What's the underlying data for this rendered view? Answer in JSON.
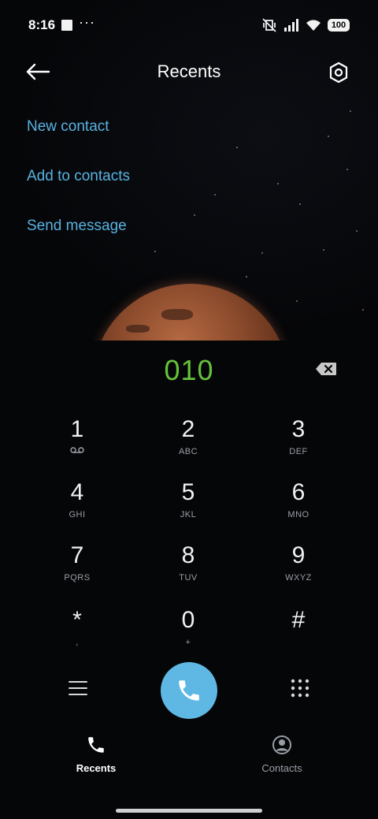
{
  "status_bar": {
    "time": "8:16",
    "more_indicator": "···",
    "battery_level": "100",
    "icons": [
      "notification-square-icon",
      "mute-vibrate-icon",
      "signal-icon",
      "wifi-icon",
      "battery-icon"
    ]
  },
  "header": {
    "title": "Recents",
    "back_icon": "back-arrow-icon",
    "settings_icon": "settings-icon"
  },
  "menu": {
    "items": [
      {
        "label": "New contact"
      },
      {
        "label": "Add to contacts"
      },
      {
        "label": "Send message"
      }
    ]
  },
  "dialer": {
    "number": "010",
    "number_color": "#67c23a",
    "keys": [
      {
        "digit": "1",
        "letters": ""
      },
      {
        "digit": "2",
        "letters": "ABC"
      },
      {
        "digit": "3",
        "letters": "DEF"
      },
      {
        "digit": "4",
        "letters": "GHI"
      },
      {
        "digit": "5",
        "letters": "JKL"
      },
      {
        "digit": "6",
        "letters": "MNO"
      },
      {
        "digit": "7",
        "letters": "PQRS"
      },
      {
        "digit": "8",
        "letters": "TUV"
      },
      {
        "digit": "9",
        "letters": "WXYZ"
      },
      {
        "digit": "*",
        "letters": ","
      },
      {
        "digit": "0",
        "letters": "+"
      },
      {
        "digit": "#",
        "letters": ""
      }
    ]
  },
  "actions": {
    "call_color": "#5fb8e4"
  },
  "bottom_nav": {
    "recents_label": "Recents",
    "contacts_label": "Contacts"
  },
  "colors": {
    "accent": "#58b2e2",
    "background": "#050608"
  }
}
